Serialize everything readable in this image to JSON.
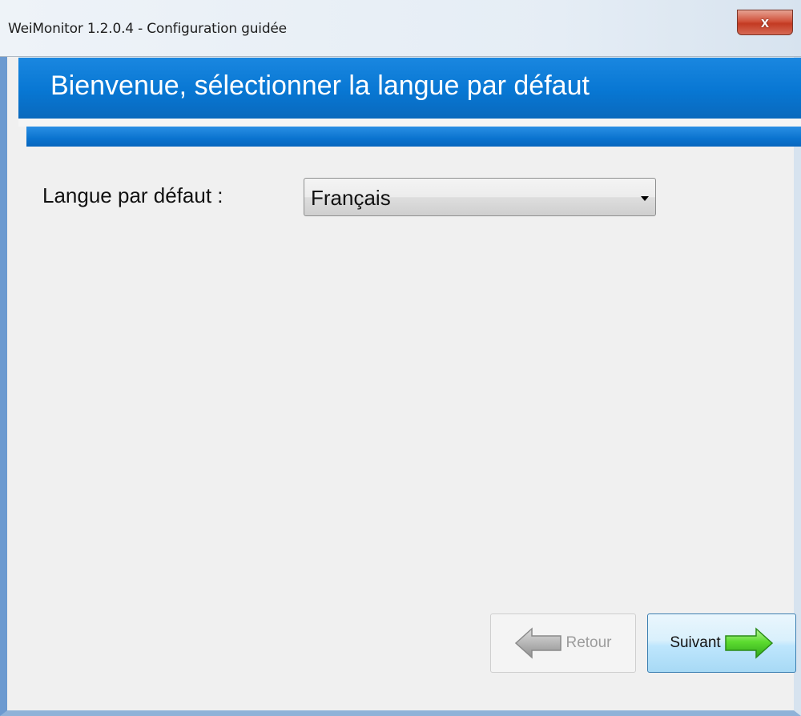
{
  "window": {
    "title": "WeiMonitor 1.2.0.4 - Configuration guidée",
    "close_icon": "close-icon",
    "close_glyph": "x"
  },
  "header": {
    "title": "Bienvenue, sélectionner la langue par défaut"
  },
  "form": {
    "language_label": "Langue par défaut :",
    "language_value": "Français"
  },
  "buttons": {
    "back_label": "Retour",
    "back_icon": "left-arrow-icon",
    "next_label": "Suivant",
    "next_icon": "right-arrow-icon"
  },
  "colors": {
    "header_blue": "#0877d3",
    "next_arrow_green": "#4cd12a",
    "back_arrow_gray": "#a9a9a9"
  }
}
